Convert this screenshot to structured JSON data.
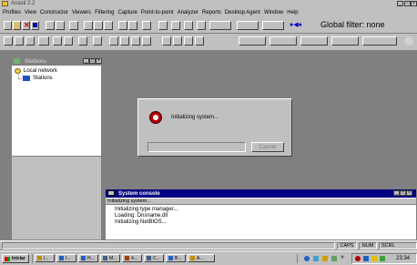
{
  "app": {
    "title": "Anasil 2.2"
  },
  "menu": [
    "Profiles",
    "View",
    "Constructor",
    "Viewers",
    "Filtering",
    "Capture",
    "Point-to-point",
    "Analyzer",
    "Reports",
    "Desktop Agent",
    "Window",
    "Help"
  ],
  "toolbar": {
    "global_filter": "Global filter: none"
  },
  "stations_panel": {
    "title": "Stations",
    "tree": {
      "root": "Local network",
      "child": "Stations"
    }
  },
  "init_dialog": {
    "message": "Initializing system...",
    "cancel_label": "Cancel"
  },
  "console": {
    "title": "System console",
    "header": "Initializing system...",
    "lines": [
      "Initializing type manager...",
      "Loading: Dnsname.dll",
      "Initializing NetBIOS..."
    ]
  },
  "statusbar": {
    "indicators": [
      "CAPS",
      "NUM",
      "SCRL"
    ]
  },
  "taskbar": {
    "start": "Iniciar",
    "buttons": [
      "I...",
      "I...",
      "H...",
      "M...",
      "4...",
      "C...",
      "B...",
      "A..."
    ],
    "clock": "23:34"
  },
  "colors": {
    "title_active": "#000080",
    "face": "#c0c0c0",
    "workspace": "#808080"
  }
}
